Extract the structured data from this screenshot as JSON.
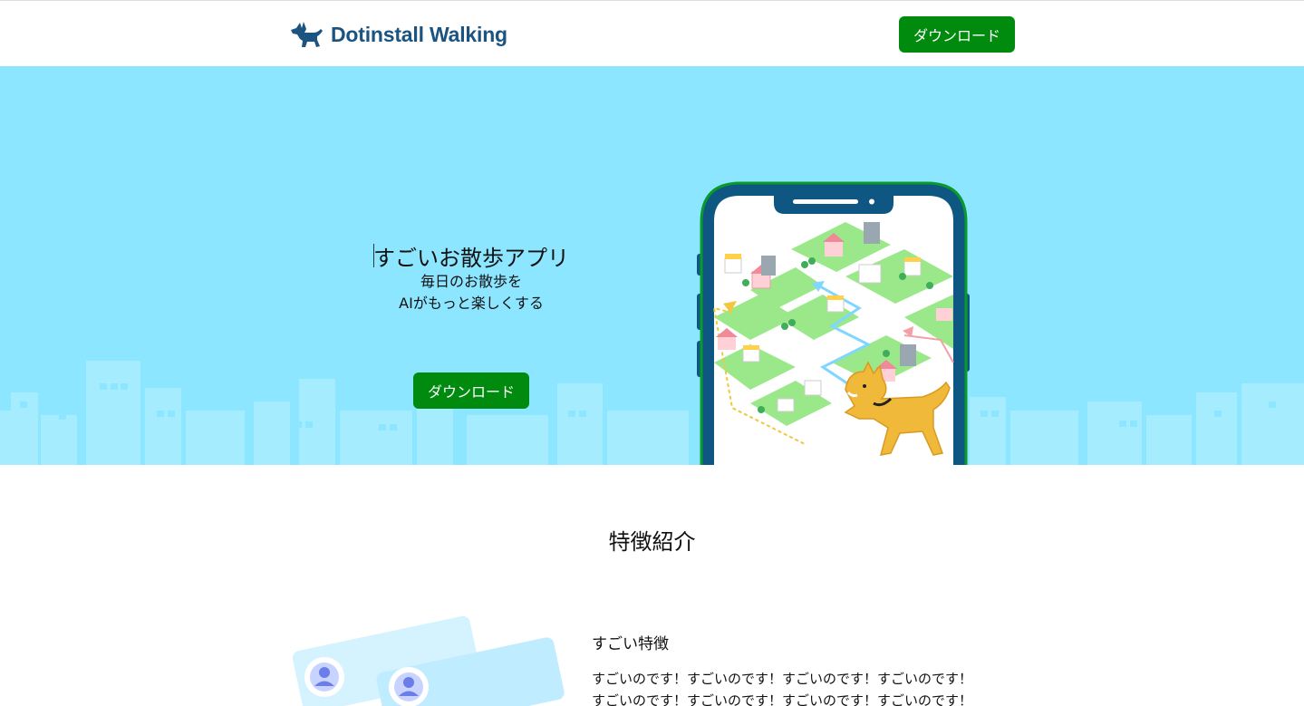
{
  "header": {
    "logo_text": "Dotinstall Walking",
    "logo_icon": "dog-icon",
    "download_label": "ダウンロード"
  },
  "hero": {
    "title": "すごいお散歩アプリ",
    "subtitle_line1": "毎日のお散歩を",
    "subtitle_line2": "AIがもっと楽しくする",
    "download_label": "ダウンロード"
  },
  "features": {
    "section_title": "特徴紹介",
    "item": {
      "heading": "すごい特徴",
      "lines": [
        "すごいのです！すごいのです！すごいのです！すごいのです！",
        "すごいのです！すごいのです！すごいのです！すごいのです！"
      ]
    }
  },
  "colors": {
    "brand": "#1b5480",
    "button": "#008a0e",
    "hero_bg": "#8ce6ff",
    "phone_frame": "#0f5783",
    "phone_border": "#0a9a2a"
  }
}
